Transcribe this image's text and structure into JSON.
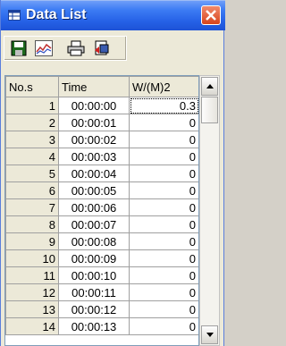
{
  "window": {
    "title": "Data List",
    "title_icon": "table-icon",
    "close_icon": "close-icon"
  },
  "toolbar": {
    "buttons": [
      {
        "icon": "save-icon"
      },
      {
        "icon": "chart-icon"
      },
      {
        "icon": "print-icon"
      },
      {
        "icon": "export-icon"
      }
    ]
  },
  "table": {
    "columns": [
      "No.s",
      "Time",
      "W/(M)2"
    ],
    "rows": [
      {
        "no": "1",
        "time": "00:00:00",
        "value": "0.3"
      },
      {
        "no": "2",
        "time": "00:00:01",
        "value": "0"
      },
      {
        "no": "3",
        "time": "00:00:02",
        "value": "0"
      },
      {
        "no": "4",
        "time": "00:00:03",
        "value": "0"
      },
      {
        "no": "5",
        "time": "00:00:04",
        "value": "0"
      },
      {
        "no": "6",
        "time": "00:00:05",
        "value": "0"
      },
      {
        "no": "7",
        "time": "00:00:06",
        "value": "0"
      },
      {
        "no": "8",
        "time": "00:00:07",
        "value": "0"
      },
      {
        "no": "9",
        "time": "00:00:08",
        "value": "0"
      },
      {
        "no": "10",
        "time": "00:00:09",
        "value": "0"
      },
      {
        "no": "11",
        "time": "00:00:10",
        "value": "0"
      },
      {
        "no": "12",
        "time": "00:00:11",
        "value": "0"
      },
      {
        "no": "13",
        "time": "00:00:12",
        "value": "0"
      },
      {
        "no": "14",
        "time": "00:00:13",
        "value": "0"
      }
    ]
  },
  "colors": {
    "titlebar": "#2561e6",
    "close_button": "#d8441c",
    "grid_line": "#a0a0a0"
  }
}
